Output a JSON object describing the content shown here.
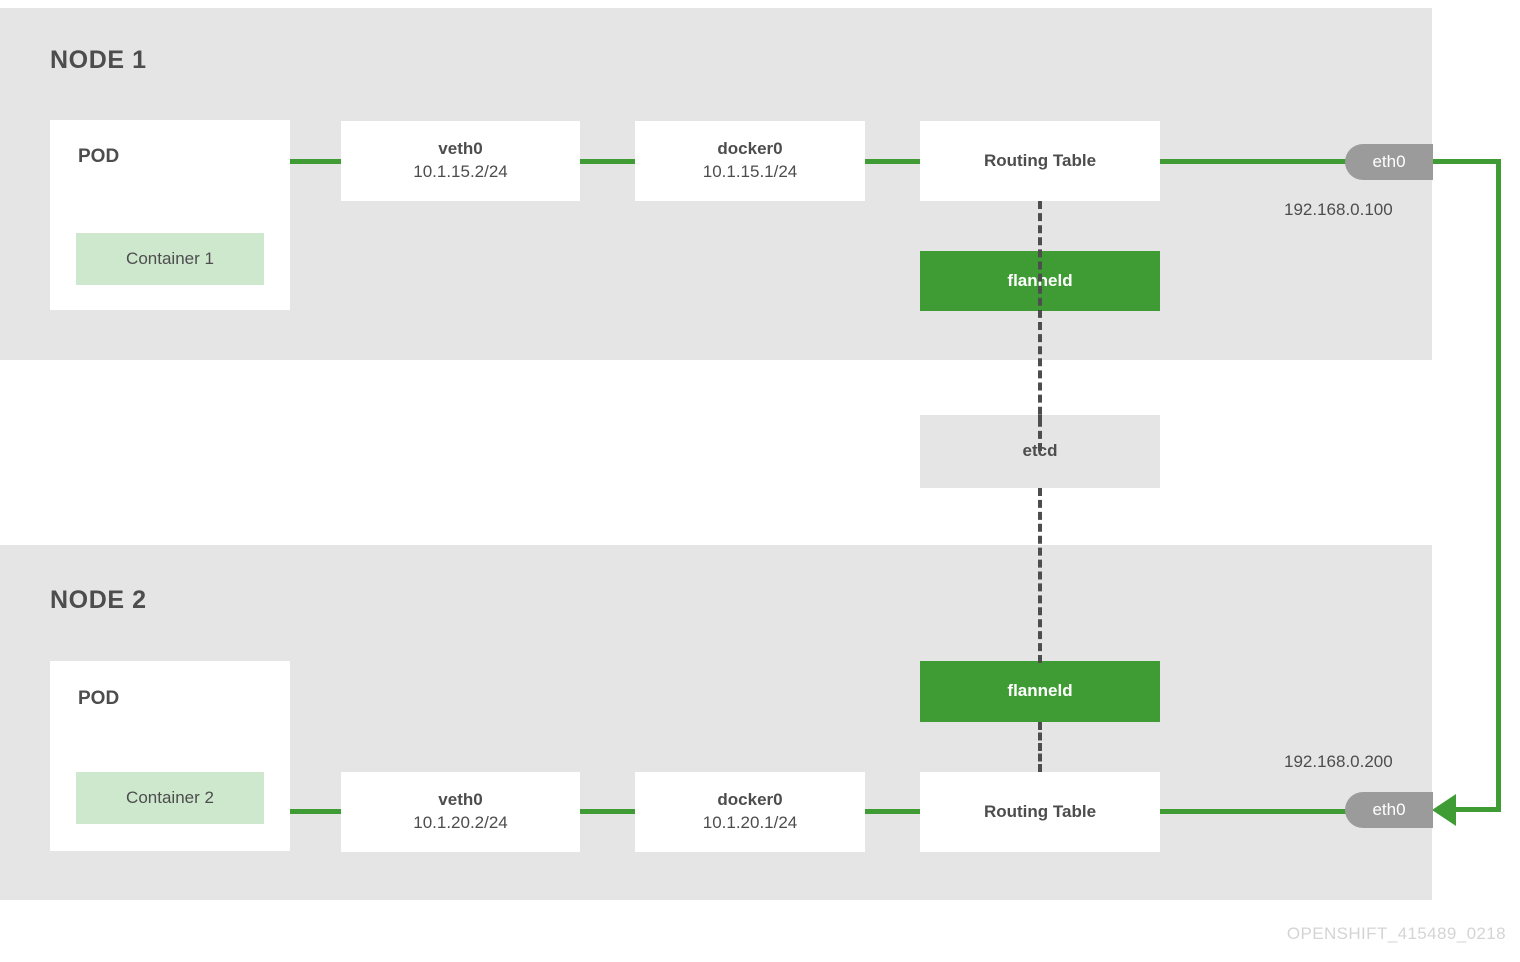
{
  "diagram": {
    "footer_id": "OPENSHIFT_415489_0218",
    "colors": {
      "panel_gray": "#e5e5e5",
      "accent_green": "#3f9c35",
      "container_green": "#cee8ce",
      "badge_gray": "#9b9b9b",
      "text_gray": "#4d4d4d"
    }
  },
  "node1": {
    "title": "NODE 1",
    "pod": {
      "label": "POD",
      "container": "Container 1"
    },
    "veth": {
      "name": "veth0",
      "cidr": "10.1.15.2/24"
    },
    "docker": {
      "name": "docker0",
      "cidr": "10.1.15.1/24"
    },
    "routing_table": "Routing Table",
    "flanneld": "flanneld",
    "eth": {
      "name": "eth0",
      "ip": "192.168.0.100"
    }
  },
  "node2": {
    "title": "NODE 2",
    "pod": {
      "label": "POD",
      "container": "Container 2"
    },
    "veth": {
      "name": "veth0",
      "cidr": "10.1.20.2/24"
    },
    "docker": {
      "name": "docker0",
      "cidr": "10.1.20.1/24"
    },
    "routing_table": "Routing Table",
    "flanneld": "flanneld",
    "eth": {
      "name": "eth0",
      "ip": "192.168.0.200"
    }
  },
  "shared": {
    "etcd": "etcd"
  }
}
